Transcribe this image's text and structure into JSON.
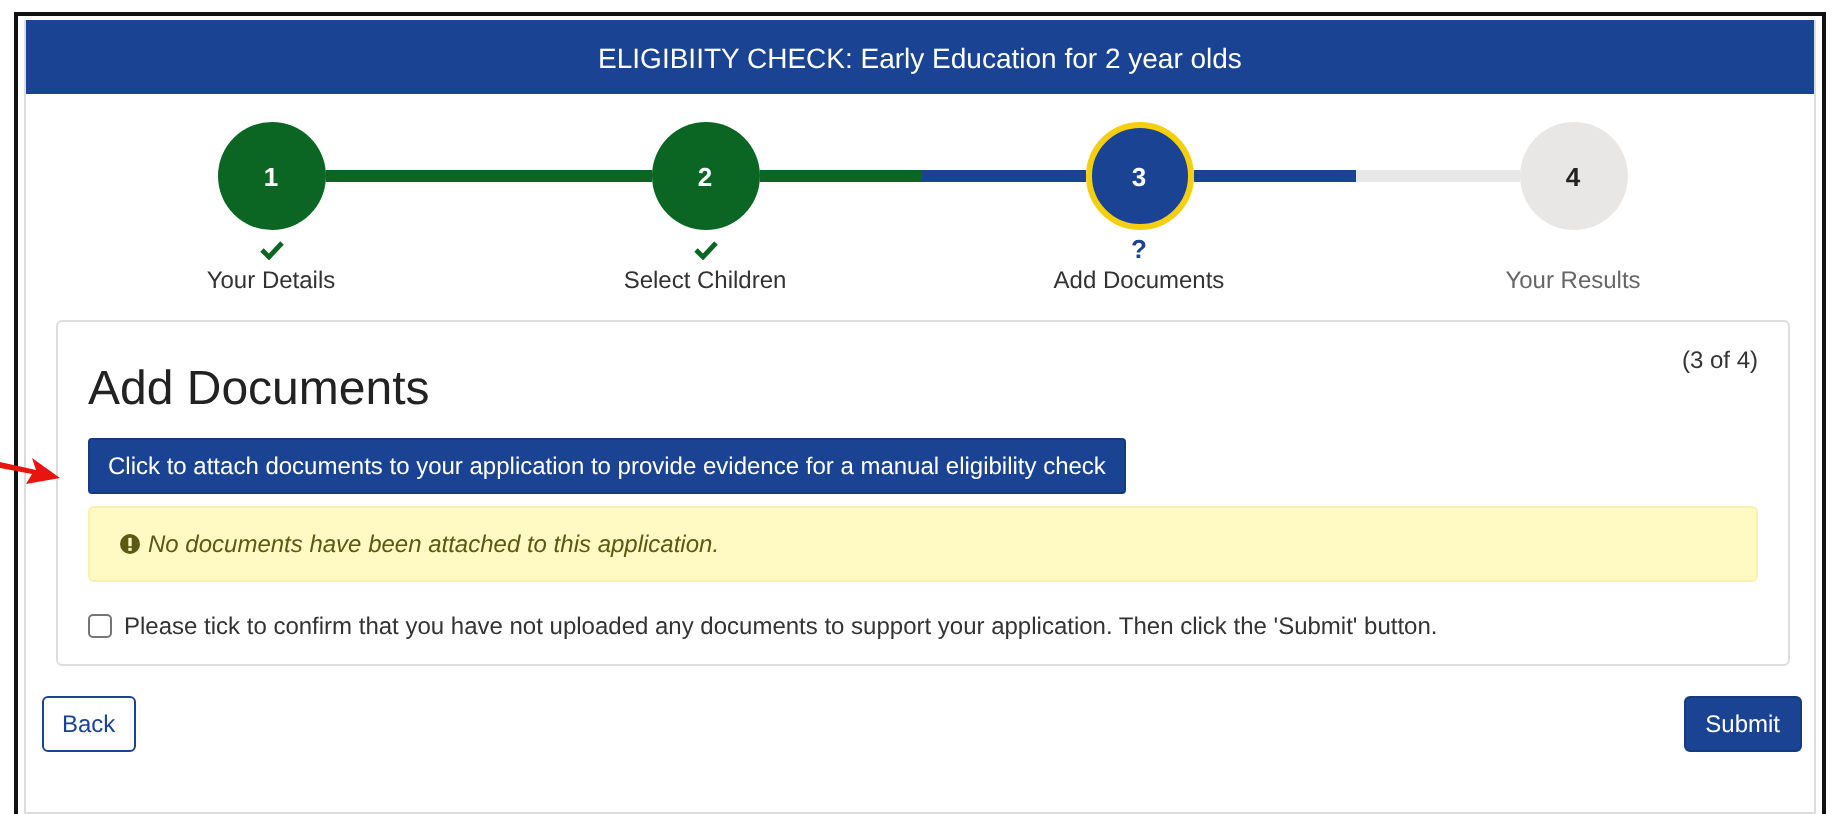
{
  "header": {
    "title": "ELIGIBIITY CHECK: Early Education for 2 year olds"
  },
  "steps": [
    {
      "number": "1",
      "label": "Your Details",
      "kind": "done"
    },
    {
      "number": "2",
      "label": "Select Children",
      "kind": "done"
    },
    {
      "number": "3",
      "label": "Add Documents",
      "kind": "current",
      "mark": "?"
    },
    {
      "number": "4",
      "label": "Your Results",
      "kind": "pending"
    }
  ],
  "card": {
    "title": "Add Documents",
    "progress": "(3 of 4)",
    "attach_button": "Click to attach documents to your application to provide evidence for a manual eligibility check",
    "alert": "No documents have been attached to this application.",
    "confirm": {
      "label": "Please tick to confirm that you have not uploaded any documents to support your application. Then click the 'Submit' button.",
      "checked": false
    }
  },
  "buttons": {
    "back": "Back",
    "submit": "Submit"
  }
}
